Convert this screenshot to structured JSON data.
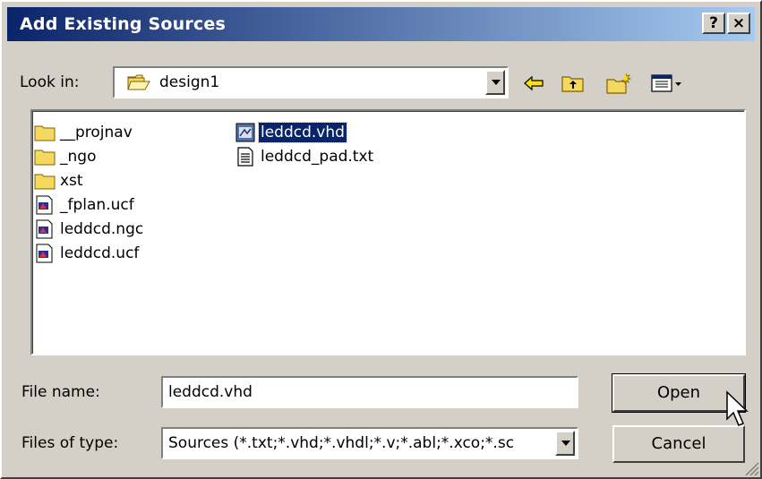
{
  "window": {
    "title": "Add Existing Sources",
    "help_label": "?",
    "close_label": "×"
  },
  "look_in": {
    "label": "Look in:",
    "value": "design1"
  },
  "toolbar": {
    "icons": [
      "back-icon",
      "up-folder-icon",
      "new-folder-icon",
      "view-menu-icon"
    ]
  },
  "files": {
    "column1": [
      {
        "name": "__projnav",
        "type": "folder"
      },
      {
        "name": "_ngo",
        "type": "folder"
      },
      {
        "name": "xst",
        "type": "folder"
      },
      {
        "name": "_fplan.ucf",
        "type": "file"
      },
      {
        "name": "leddcd.ngc",
        "type": "file"
      },
      {
        "name": "leddcd.ucf",
        "type": "file"
      }
    ],
    "column2": [
      {
        "name": "leddcd.vhd",
        "type": "vhd",
        "selected": true
      },
      {
        "name": "leddcd_pad.txt",
        "type": "txt"
      }
    ]
  },
  "file_name": {
    "label": "File name:",
    "value": "leddcd.vhd"
  },
  "file_type": {
    "label": "Files of type:",
    "value": "Sources (*.txt;*.vhd;*.vhdl;*.v;*.abl;*.xco;*.sc"
  },
  "buttons": {
    "open": "Open",
    "cancel": "Cancel"
  },
  "colors": {
    "title_start": "#0a246a",
    "title_end": "#a6caf0",
    "face": "#d4d0c8",
    "selection": "#0a246a"
  }
}
